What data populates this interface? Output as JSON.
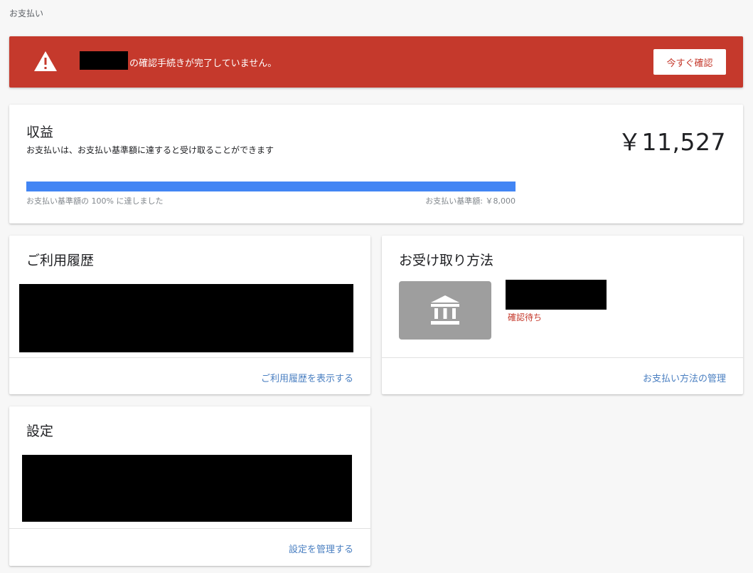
{
  "breadcrumb": "お支払い",
  "alert": {
    "message": "の確認手続きが完了していません。",
    "button_label": "今すぐ確認",
    "icon": "warning-icon"
  },
  "earnings": {
    "title": "収益",
    "subtitle": "お支払いは、お支払い基準額に達すると受け取ることができます",
    "amount": "￥11,527",
    "progress_percent": 100,
    "progress_text": "お支払い基準額の 100% に達しました",
    "threshold_text": "お支払い基準額: ￥8,000"
  },
  "history": {
    "title": "ご利用履歴",
    "link": "ご利用履歴を表示する"
  },
  "payment_method": {
    "title": "お受け取り方法",
    "status": "確認待ち",
    "link": "お支払い方法の管理",
    "icon": "bank-icon"
  },
  "settings": {
    "title": "設定",
    "link": "設定を管理する"
  },
  "colors": {
    "alert_bg": "#c5392c",
    "progress": "#4285f4",
    "link": "#4a7fc1"
  }
}
